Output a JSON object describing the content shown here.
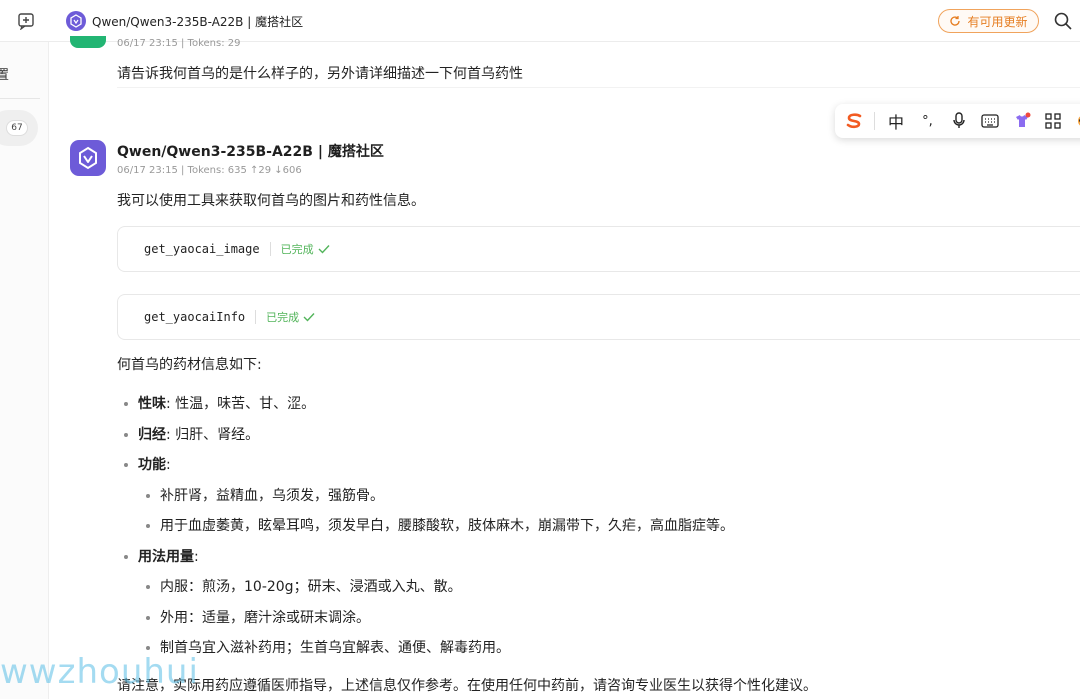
{
  "header": {
    "title": "Qwen/Qwen3-235B-A22B | 魔搭社区",
    "update_label": "有可用更新"
  },
  "sidebar": {
    "partial_text": "置",
    "badge_count": "67"
  },
  "user_message": {
    "meta": "06/17 23:15 | Tokens: 29",
    "text": "请告诉我何首乌的是什么样子的，另外请详细描述一下何首乌药性"
  },
  "ime_toolbar": {
    "items": [
      "sogou-logo-icon",
      "中",
      "°,",
      "microphone-icon",
      "keyboard-icon",
      "skin-icon",
      "grid-icon",
      "avatar-icon"
    ],
    "lang_label": "中",
    "punct_label": "°,"
  },
  "assistant_message": {
    "name": "Qwen/Qwen3-235B-A22B | 魔搭社区",
    "meta": "06/17 23:15 | Tokens: 635 ↑29 ↓606",
    "intro": "我可以使用工具来获取何首乌的图片和药性信息。",
    "tool_calls": [
      {
        "name": "get_yaocai_image",
        "status": "已完成"
      },
      {
        "name": "get_yaocaiInfo",
        "status": "已完成"
      }
    ],
    "heading": "何首乌的药材信息如下:",
    "list": {
      "xingwei_label": "性味",
      "xingwei_text": ": 性温，味苦、甘、涩。",
      "guijing_label": "归经",
      "guijing_text": ": 归肝、肾经。",
      "gongneng_label": "功能",
      "gongneng_colon": ":",
      "gongneng_items": [
        "补肝肾，益精血，乌须发，强筋骨。",
        "用于血虚萎黄，眩晕耳鸣，须发早白，腰膝酸软，肢体麻木，崩漏带下，久疟，高血脂症等。"
      ],
      "yongfa_label": "用法用量",
      "yongfa_colon": ":",
      "yongfa_items": [
        "内服：煎汤，10-20g；研末、浸酒或入丸、散。",
        "外用：适量，磨汁涂或研末调涂。",
        "制首乌宜入滋补药用；生首乌宜解表、通便、解毒药用。"
      ]
    },
    "note": "请注意，实际用药应遵循医师指导，上述信息仅作参考。在使用任何中药前，请咨询专业医生以获得个性化建议。"
  },
  "watermark": "wwzhouhui",
  "colors": {
    "brand_purple": "#6d5bd8",
    "update_orange": "#e67e22",
    "success_green": "#52b45a",
    "user_avatar_green": "#22b573"
  }
}
